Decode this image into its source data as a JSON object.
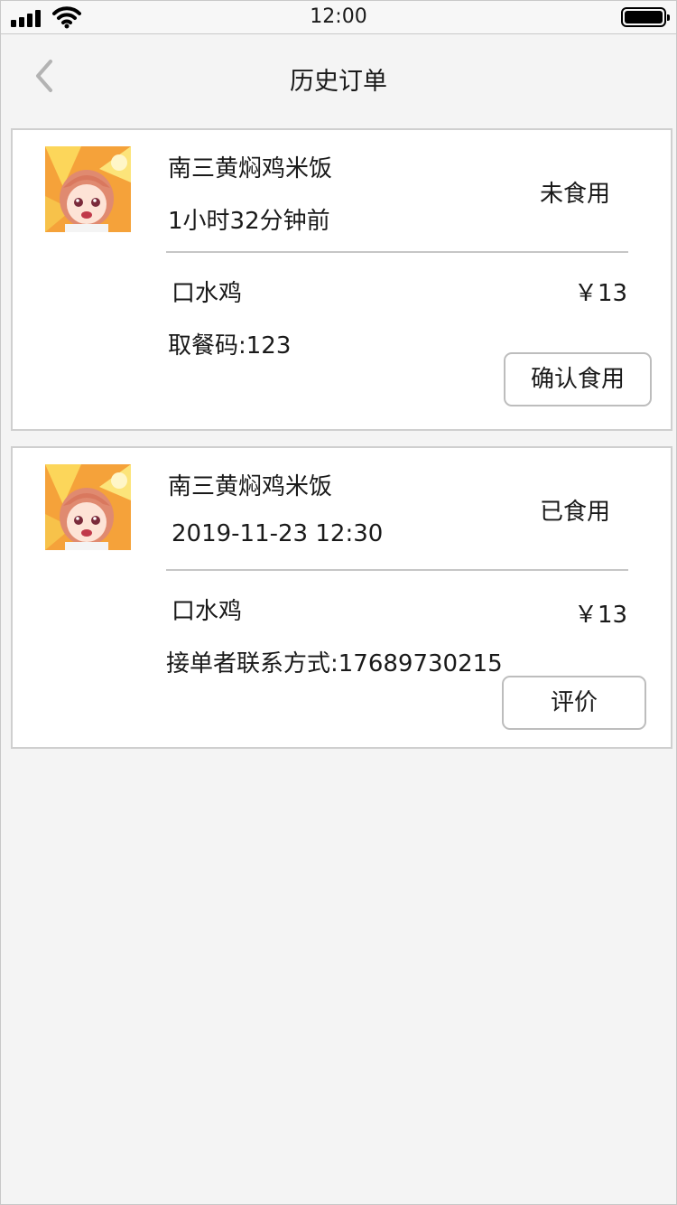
{
  "status_bar": {
    "time": "12:00"
  },
  "nav": {
    "title": "历史订单"
  },
  "orders": [
    {
      "shop": "南三黄焖鸡米饭",
      "subtitle": "1小时32分钟前",
      "status": "未食用",
      "item": "口水鸡",
      "price": "￥13",
      "extra": "取餐码:123",
      "action": "确认食用"
    },
    {
      "shop": "南三黄焖鸡米饭",
      "subtitle": "2019-11-23 12:30",
      "status": "已食用",
      "item": "口水鸡",
      "price": "￥13",
      "extra": "接单者联系方式:17689730215",
      "action": "评价"
    }
  ],
  "icons": {
    "back": "chevron-left-icon",
    "signal": "cellular-signal-icon",
    "wifi": "wifi-icon",
    "battery": "battery-icon",
    "thumbnail": "anime-girl-avatar"
  },
  "colors": {
    "background": "#f4f4f4",
    "card": "#ffffff",
    "border": "#cfcfcf",
    "text": "#1a1a1a"
  }
}
